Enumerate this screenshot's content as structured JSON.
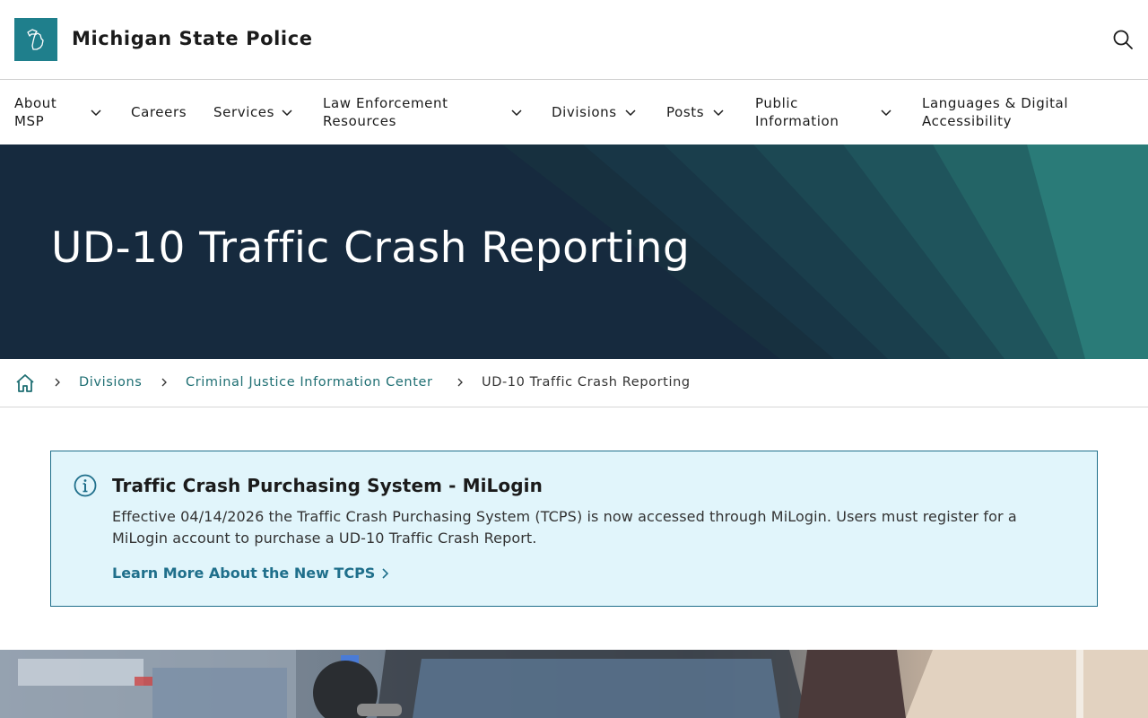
{
  "header": {
    "site_title": "Michigan State Police",
    "logo_icon": "michigan-map-icon",
    "search_icon": "search-icon"
  },
  "nav": {
    "items": [
      {
        "label_line1": "About",
        "label_line2": "MSP",
        "has_dropdown": true
      },
      {
        "label_line1": "Careers",
        "label_line2": "",
        "has_dropdown": false
      },
      {
        "label_line1": "Services",
        "label_line2": "",
        "has_dropdown": true
      },
      {
        "label_line1": "Law Enforcement",
        "label_line2": "Resources",
        "has_dropdown": true
      },
      {
        "label_line1": "Divisions",
        "label_line2": "",
        "has_dropdown": true
      },
      {
        "label_line1": "Posts",
        "label_line2": "",
        "has_dropdown": true
      },
      {
        "label_line1": "Public",
        "label_line2": "Information",
        "has_dropdown": true
      },
      {
        "label_line1": "Languages & Digital",
        "label_line2": "Accessibility",
        "has_dropdown": false
      }
    ]
  },
  "hero": {
    "title": "UD-10 Traffic Crash Reporting"
  },
  "breadcrumb": {
    "home_icon": "home-icon",
    "items": [
      {
        "label": "Divisions"
      },
      {
        "label": "Criminal Justice Information Center"
      },
      {
        "label": "UD-10 Traffic Crash Reporting"
      }
    ]
  },
  "alert": {
    "icon": "info-icon",
    "title": "Traffic Crash Purchasing System - MiLogin",
    "body": "Effective 04/14/2026 the Traffic Crash Purchasing System (TCPS) is now accessed through MiLogin. Users must register for a MiLogin account to purchase a UD-10 Traffic Crash Report.",
    "link_label": "Learn More About the New TCPS"
  },
  "colors": {
    "brand_teal": "#1f7f8c",
    "hero_navy": "#162a3e",
    "link_teal": "#1f6f73",
    "alert_bg": "#e1f5fb",
    "alert_border": "#1f6f8b"
  }
}
